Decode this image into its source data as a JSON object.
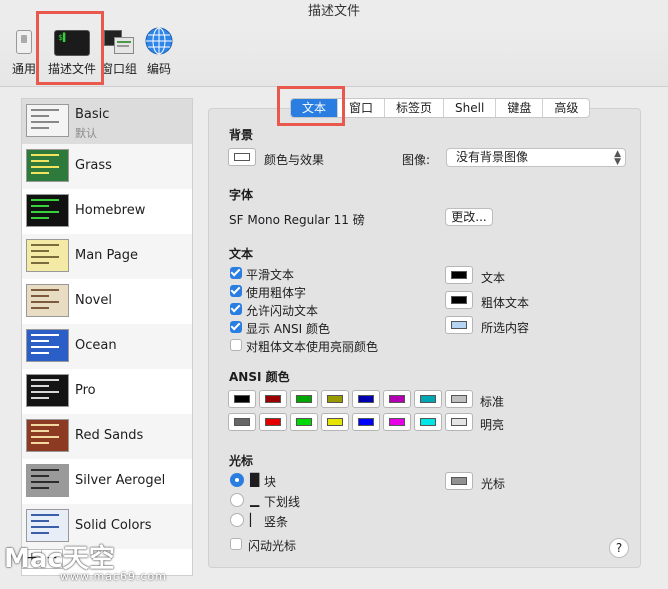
{
  "window": {
    "title": "描述文件"
  },
  "toolbar": {
    "items": [
      {
        "label": "通用",
        "icon": "switch-icon"
      },
      {
        "label": "描述文件",
        "icon": "terminal-icon"
      },
      {
        "label": "窗口组",
        "icon": "window-groups-icon"
      },
      {
        "label": "编码",
        "icon": "globe-icon"
      }
    ],
    "selected": "描述文件"
  },
  "profiles": [
    {
      "name": "Basic",
      "sub": "默认",
      "bg": "#f4f4f4",
      "bar": "#888888"
    },
    {
      "name": "Grass",
      "bg": "#2e7a3c",
      "bar": "#f2e25c"
    },
    {
      "name": "Homebrew",
      "bg": "#111111",
      "bar": "#38d23c"
    },
    {
      "name": "Man Page",
      "bg": "#f3eaa6",
      "bar": "#7a6c3c"
    },
    {
      "name": "Novel",
      "bg": "#e8dcc2",
      "bar": "#7c5a3c"
    },
    {
      "name": "Ocean",
      "bg": "#2c5ec8",
      "bar": "#ffffff"
    },
    {
      "name": "Pro",
      "bg": "#141414",
      "bar": "#d8d8d8"
    },
    {
      "name": "Red Sands",
      "bg": "#8c3a22",
      "bar": "#f0d8a0"
    },
    {
      "name": "Silver Aerogel",
      "bg": "#9a9a9a",
      "bar": "#2c2c2c"
    },
    {
      "name": "Solid Colors",
      "bg": "#e8eef8",
      "bar": "#3a5ea8"
    }
  ],
  "tabs": [
    "文本",
    "窗口",
    "标签页",
    "Shell",
    "键盘",
    "高级"
  ],
  "active_tab": "文本",
  "background": {
    "heading": "背景",
    "color_effect_label": "颜色与效果",
    "image_label": "图像:",
    "image_value": "没有背景图像"
  },
  "font": {
    "heading": "字体",
    "value": "SF Mono Regular 11 磅",
    "change_button": "更改..."
  },
  "text": {
    "heading": "文本",
    "options": [
      {
        "label": "平滑文本",
        "checked": true
      },
      {
        "label": "使用粗体字",
        "checked": true
      },
      {
        "label": "允许闪动文本",
        "checked": true
      },
      {
        "label": "显示 ANSI 颜色",
        "checked": true
      },
      {
        "label": "对粗体文本使用亮丽颜色",
        "checked": false
      }
    ],
    "colors": [
      {
        "label": "文本",
        "color": "#000000"
      },
      {
        "label": "粗体文本",
        "color": "#000000"
      },
      {
        "label": "所选内容",
        "color": "#b4d4f4"
      }
    ]
  },
  "ansi": {
    "heading": "ANSI 颜色",
    "normal_label": "标准",
    "bright_label": "明亮",
    "normal": [
      "#000000",
      "#990000",
      "#00a600",
      "#999900",
      "#0000b2",
      "#b200b2",
      "#00a6b2",
      "#bfbfbf"
    ],
    "bright": [
      "#666666",
      "#e50000",
      "#00d900",
      "#e5e500",
      "#0000ff",
      "#e500e5",
      "#00e5e5",
      "#e5e5e5"
    ]
  },
  "cursor": {
    "heading": "光标",
    "options": [
      {
        "glyph": "█",
        "label": "块",
        "selected": true
      },
      {
        "glyph": "▁",
        "label": "下划线",
        "selected": false
      },
      {
        "glyph": "▏",
        "label": "竖条",
        "selected": false
      }
    ],
    "blink_label": "闪动光标",
    "blink_checked": false,
    "color_label": "光标",
    "color": "#929292"
  },
  "help_label": "?",
  "watermark": {
    "main": "Mac天空",
    "url": "www.mac69.com"
  },
  "accent": "#2a7de1",
  "highlight": "#e8584c"
}
